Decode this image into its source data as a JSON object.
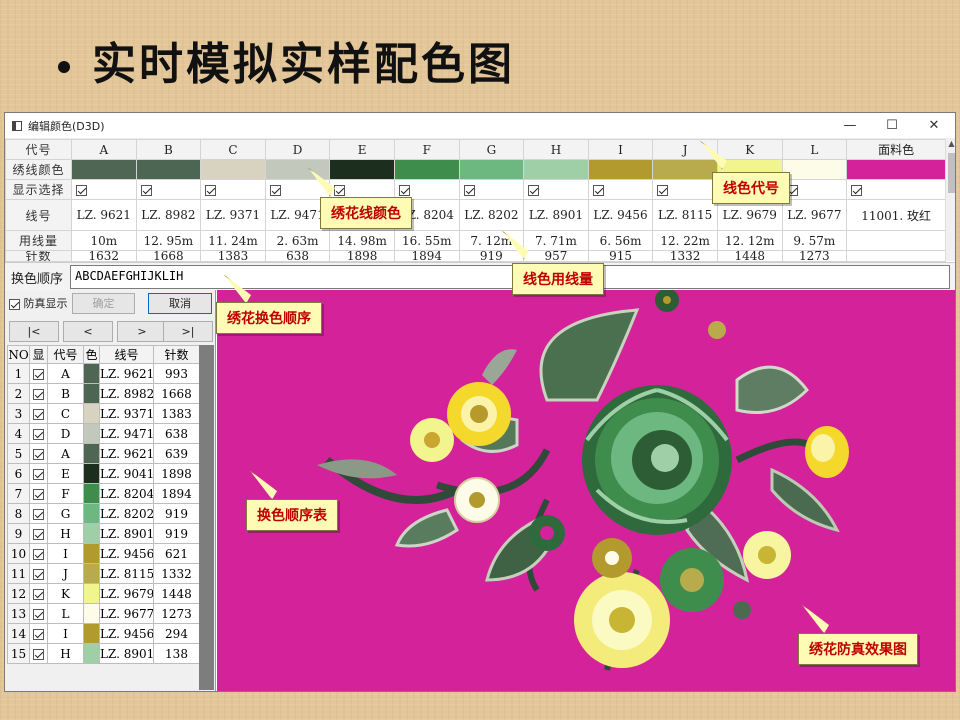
{
  "slide": {
    "title": "实时模拟实样配色图"
  },
  "window": {
    "title": "编辑颜色(D3D)",
    "controls": [
      "—",
      "☐",
      "✕"
    ]
  },
  "grid": {
    "row_labels": {
      "code": "代号",
      "color": "绣线颜色",
      "show": "显示选择",
      "thread": "线号",
      "usage": "用线量",
      "stitches": "针数"
    },
    "columns": [
      {
        "code": "A",
        "color": "#4f6655",
        "show": true,
        "thread": "LZ. 9621",
        "usage": "10m",
        "stitches": "1632"
      },
      {
        "code": "B",
        "color": "#4d6553",
        "show": true,
        "thread": "LZ. 8982",
        "usage": "12. 95m",
        "stitches": "1668"
      },
      {
        "code": "C",
        "color": "#d8d2c0",
        "show": true,
        "thread": "LZ. 9371",
        "usage": "11. 24m",
        "stitches": "1383"
      },
      {
        "code": "D",
        "color": "#c2c8bc",
        "show": true,
        "thread": "LZ. 9471",
        "usage": "2. 63m",
        "stitches": "638"
      },
      {
        "code": "E",
        "color": "#1c2e1e",
        "show": true,
        "thread": "LZ. 9041",
        "usage": "14. 98m",
        "stitches": "1898"
      },
      {
        "code": "F",
        "color": "#3f8d4c",
        "show": true,
        "thread": "LZ. 8204",
        "usage": "16. 55m",
        "stitches": "1894"
      },
      {
        "code": "G",
        "color": "#6db781",
        "show": true,
        "thread": "LZ. 8202",
        "usage": "7. 12m",
        "stitches": "919"
      },
      {
        "code": "H",
        "color": "#9fcfa7",
        "show": true,
        "thread": "LZ. 8901",
        "usage": "7. 71m",
        "stitches": "957"
      },
      {
        "code": "I",
        "color": "#b39a2f",
        "show": true,
        "thread": "LZ. 9456",
        "usage": "6. 56m",
        "stitches": "915"
      },
      {
        "code": "J",
        "color": "#b8ab4d",
        "show": true,
        "thread": "LZ. 8115",
        "usage": "12. 22m",
        "stitches": "1332"
      },
      {
        "code": "K",
        "color": "#f2f48e",
        "show": true,
        "thread": "LZ. 9679",
        "usage": "12. 12m",
        "stitches": "1448"
      },
      {
        "code": "L",
        "color": "#fcfce8",
        "show": true,
        "thread": "LZ. 9677",
        "usage": "9. 57m",
        "stitches": "1273"
      },
      {
        "code": "面料色",
        "color": "#d4239a",
        "show": true,
        "thread": "11001. 玫红",
        "usage": "",
        "stitches": ""
      }
    ]
  },
  "sequence": {
    "label": "换色顺序",
    "value": "ABCDAEFGHIJKLIH"
  },
  "left": {
    "realistic_label": "防真显示",
    "realistic_checked": true,
    "ok": "确定",
    "cancel": "取消",
    "nav": [
      "|<",
      "<",
      ">",
      ">|"
    ],
    "list_headers": [
      "NO",
      "显",
      "代号",
      "色",
      "线号",
      "针数"
    ],
    "rows": [
      {
        "no": "1",
        "code": "A",
        "color": "#4f6655",
        "thread": "LZ. 9621",
        "stitches": "993"
      },
      {
        "no": "2",
        "code": "B",
        "color": "#4d6553",
        "thread": "LZ. 8982",
        "stitches": "1668"
      },
      {
        "no": "3",
        "code": "C",
        "color": "#d8d2c0",
        "thread": "LZ. 9371",
        "stitches": "1383"
      },
      {
        "no": "4",
        "code": "D",
        "color": "#c2c8bc",
        "thread": "LZ. 9471",
        "stitches": "638"
      },
      {
        "no": "5",
        "code": "A",
        "color": "#4f6655",
        "thread": "LZ. 9621",
        "stitches": "639"
      },
      {
        "no": "6",
        "code": "E",
        "color": "#1c2e1e",
        "thread": "LZ. 9041",
        "stitches": "1898"
      },
      {
        "no": "7",
        "code": "F",
        "color": "#3f8d4c",
        "thread": "LZ. 8204",
        "stitches": "1894"
      },
      {
        "no": "8",
        "code": "G",
        "color": "#6db781",
        "thread": "LZ. 8202",
        "stitches": "919"
      },
      {
        "no": "9",
        "code": "H",
        "color": "#9fcfa7",
        "thread": "LZ. 8901",
        "stitches": "919"
      },
      {
        "no": "10",
        "code": "I",
        "color": "#b39a2f",
        "thread": "LZ. 9456",
        "stitches": "621"
      },
      {
        "no": "11",
        "code": "J",
        "color": "#b8ab4d",
        "thread": "LZ. 8115",
        "stitches": "1332"
      },
      {
        "no": "12",
        "code": "K",
        "color": "#f2f48e",
        "thread": "LZ. 9679",
        "stitches": "1448"
      },
      {
        "no": "13",
        "code": "L",
        "color": "#fcfce8",
        "thread": "LZ. 9677",
        "stitches": "1273"
      },
      {
        "no": "14",
        "code": "I",
        "color": "#b39a2f",
        "thread": "LZ. 9456",
        "stitches": "294"
      },
      {
        "no": "15",
        "code": "H",
        "color": "#9fcfa7",
        "thread": "LZ. 8901",
        "stitches": "138"
      }
    ]
  },
  "callouts": {
    "thread_code": "线色代号",
    "thread_color": "绣花线颜色",
    "thread_usage": "线色用线量",
    "color_sequence": "绣花换色顺序",
    "sequence_table": "换色顺序表",
    "preview": "绣花防真效果图"
  },
  "colors": {
    "fabric": "#d4239a",
    "callout_bg": "#fefcb4",
    "callout_text": "#c00000"
  }
}
